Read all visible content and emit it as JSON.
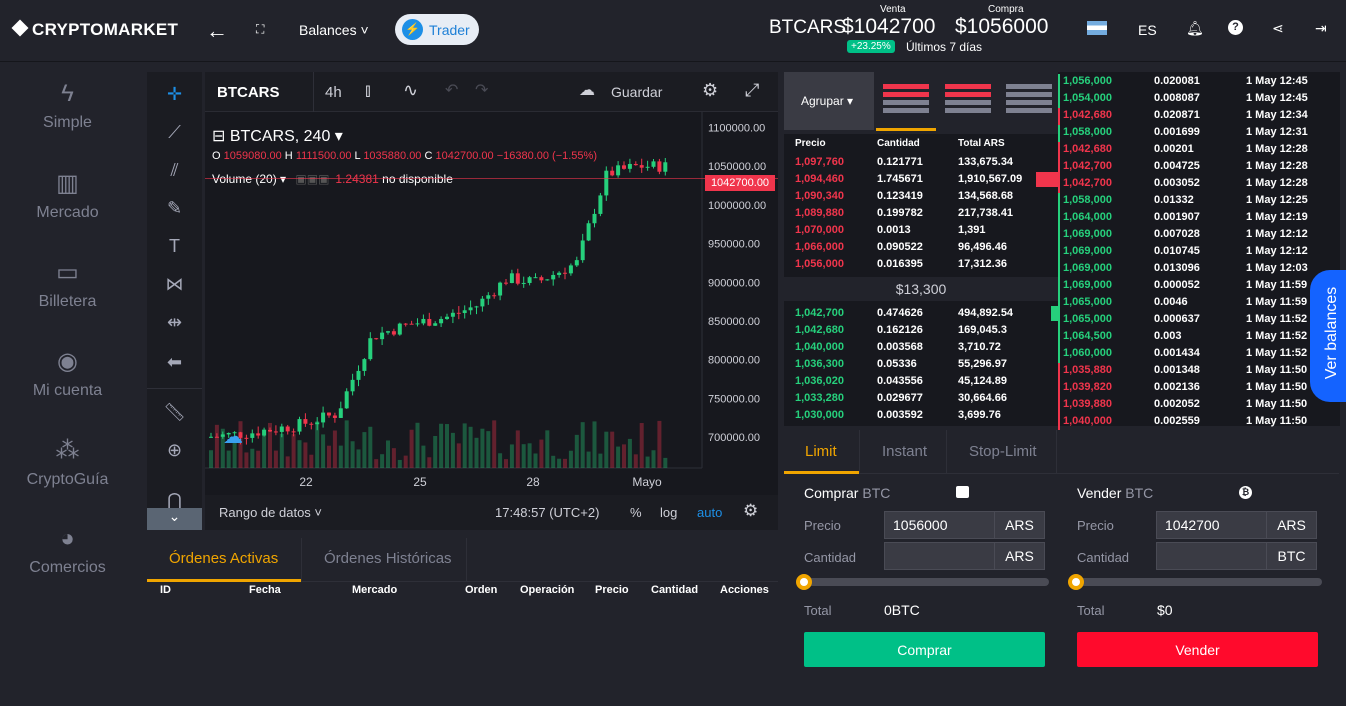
{
  "header": {
    "logo": "CRYPTOMARKET",
    "balances": "Balances",
    "trader": "Trader",
    "pair": "BTCARS",
    "venta_label": "Venta",
    "compra_label": "Compra",
    "venta_price": "$1042700",
    "compra_price": "$1056000",
    "change": "+23.25%",
    "change_period": "Últimos 7 días",
    "lang": "ES"
  },
  "sidebar": {
    "items": [
      {
        "label": "Simple",
        "icon": "bolt-icon"
      },
      {
        "label": "Mercado",
        "icon": "bar-chart-icon"
      },
      {
        "label": "Billetera",
        "icon": "wallet-icon"
      },
      {
        "label": "Mi cuenta",
        "icon": "user-icon"
      },
      {
        "label": "CryptoGuía",
        "icon": "group-icon"
      },
      {
        "label": "Comercios",
        "icon": "store-icon"
      }
    ]
  },
  "chart": {
    "symbol": "BTCARS",
    "interval": "4h",
    "save": "Guardar",
    "title": "BTCARS, 240",
    "o": "1059080.00",
    "h": "1111500.00",
    "l": "1035880.00",
    "c": "1042700.00",
    "change": "−16380.00 (−1.55%)",
    "volume_label": "Volume (20)",
    "volume_value": "1.24381",
    "volume_na": "no disponible",
    "last_price": "1042700.00",
    "range_label": "Rango de datos",
    "time": "17:48:57 (UTC+2)",
    "pct": "%",
    "log": "log",
    "auto": "auto"
  },
  "chart_data": {
    "type": "candlestick",
    "x_ticks": [
      "22",
      "25",
      "28",
      "Mayo"
    ],
    "y_ticks": [
      "1100000.00",
      "1050000.00",
      "1000000.00",
      "950000.00",
      "900000.00",
      "850000.00",
      "800000.00",
      "750000.00",
      "700000.00"
    ],
    "ylim": [
      660000,
      1120000
    ],
    "up_color": "#26d07c",
    "down_color": "#f0354c"
  },
  "orders": {
    "tab_active": "Órdenes Activas",
    "tab_history": "Órdenes Históricas",
    "columns": [
      "ID",
      "Fecha",
      "Mercado",
      "Orden",
      "Operación",
      "Precio",
      "Cantidad",
      "Acciones"
    ]
  },
  "orderbook": {
    "agrupar": "Agrupar",
    "headers": [
      "Precio",
      "Cantidad",
      "Total ARS"
    ],
    "spread": "$13,300",
    "asks": [
      [
        "1,097,760",
        "0.121771",
        "133,675.34"
      ],
      [
        "1,094,460",
        "1.745671",
        "1,910,567.09"
      ],
      [
        "1,090,340",
        "0.123419",
        "134,568.68"
      ],
      [
        "1,089,880",
        "0.199782",
        "217,738.41"
      ],
      [
        "1,070,000",
        "0.0013",
        "1,391"
      ],
      [
        "1,066,000",
        "0.090522",
        "96,496.46"
      ],
      [
        "1,056,000",
        "0.016395",
        "17,312.36"
      ]
    ],
    "bids": [
      [
        "1,042,700",
        "0.474626",
        "494,892.54"
      ],
      [
        "1,042,680",
        "0.162126",
        "169,045.3"
      ],
      [
        "1,040,000",
        "0.003568",
        "3,710.72"
      ],
      [
        "1,036,300",
        "0.05336",
        "55,296.97"
      ],
      [
        "1,036,020",
        "0.043556",
        "45,124.89"
      ],
      [
        "1,033,280",
        "0.029677",
        "30,664.66"
      ],
      [
        "1,030,000",
        "0.003592",
        "3,699.76"
      ]
    ]
  },
  "trades": [
    [
      "1,056,000",
      "0.020081",
      "1 May 12:45",
      "g"
    ],
    [
      "1,054,000",
      "0.008087",
      "1 May 12:45",
      "g"
    ],
    [
      "1,042,680",
      "0.020871",
      "1 May 12:34",
      "r"
    ],
    [
      "1,058,000",
      "0.001699",
      "1 May 12:31",
      "g"
    ],
    [
      "1,042,680",
      "0.00201",
      "1 May 12:28",
      "r"
    ],
    [
      "1,042,700",
      "0.004725",
      "1 May 12:28",
      "r"
    ],
    [
      "1,042,700",
      "0.003052",
      "1 May 12:28",
      "r"
    ],
    [
      "1,058,000",
      "0.01332",
      "1 May 12:25",
      "g"
    ],
    [
      "1,064,000",
      "0.001907",
      "1 May 12:19",
      "g"
    ],
    [
      "1,069,000",
      "0.007028",
      "1 May 12:12",
      "g"
    ],
    [
      "1,069,000",
      "0.010745",
      "1 May 12:12",
      "g"
    ],
    [
      "1,069,000",
      "0.013096",
      "1 May 12:03",
      "g"
    ],
    [
      "1,069,000",
      "0.000052",
      "1 May 11:59",
      "g"
    ],
    [
      "1,065,000",
      "0.0046",
      "1 May 11:59",
      "g"
    ],
    [
      "1,065,000",
      "0.000637",
      "1 May 11:52",
      "g"
    ],
    [
      "1,064,500",
      "0.003",
      "1 May 11:52",
      "g"
    ],
    [
      "1,060,000",
      "0.001434",
      "1 May 11:52",
      "g"
    ],
    [
      "1,035,880",
      "0.001348",
      "1 May 11:50",
      "r"
    ],
    [
      "1,039,820",
      "0.002136",
      "1 May 11:50",
      "r"
    ],
    [
      "1,039,880",
      "0.002052",
      "1 May 11:50",
      "r"
    ],
    [
      "1,040,000",
      "0.002559",
      "1 May 11:50",
      "r"
    ]
  ],
  "ver_balances": "Ver balances",
  "form": {
    "tabs": [
      "Limit",
      "Instant",
      "Stop-Limit"
    ],
    "buy": {
      "title": "Comprar",
      "asset": "BTC",
      "price_label": "Precio",
      "price": "1056000",
      "price_unit": "ARS",
      "qty_label": "Cantidad",
      "qty_unit": "ARS",
      "total_label": "Total",
      "total": "0BTC",
      "button": "Comprar"
    },
    "sell": {
      "title": "Vender",
      "asset": "BTC",
      "price_label": "Precio",
      "price": "1042700",
      "price_unit": "ARS",
      "qty_label": "Cantidad",
      "qty_unit": "BTC",
      "total_label": "Total",
      "total": "$0",
      "button": "Vender"
    }
  }
}
